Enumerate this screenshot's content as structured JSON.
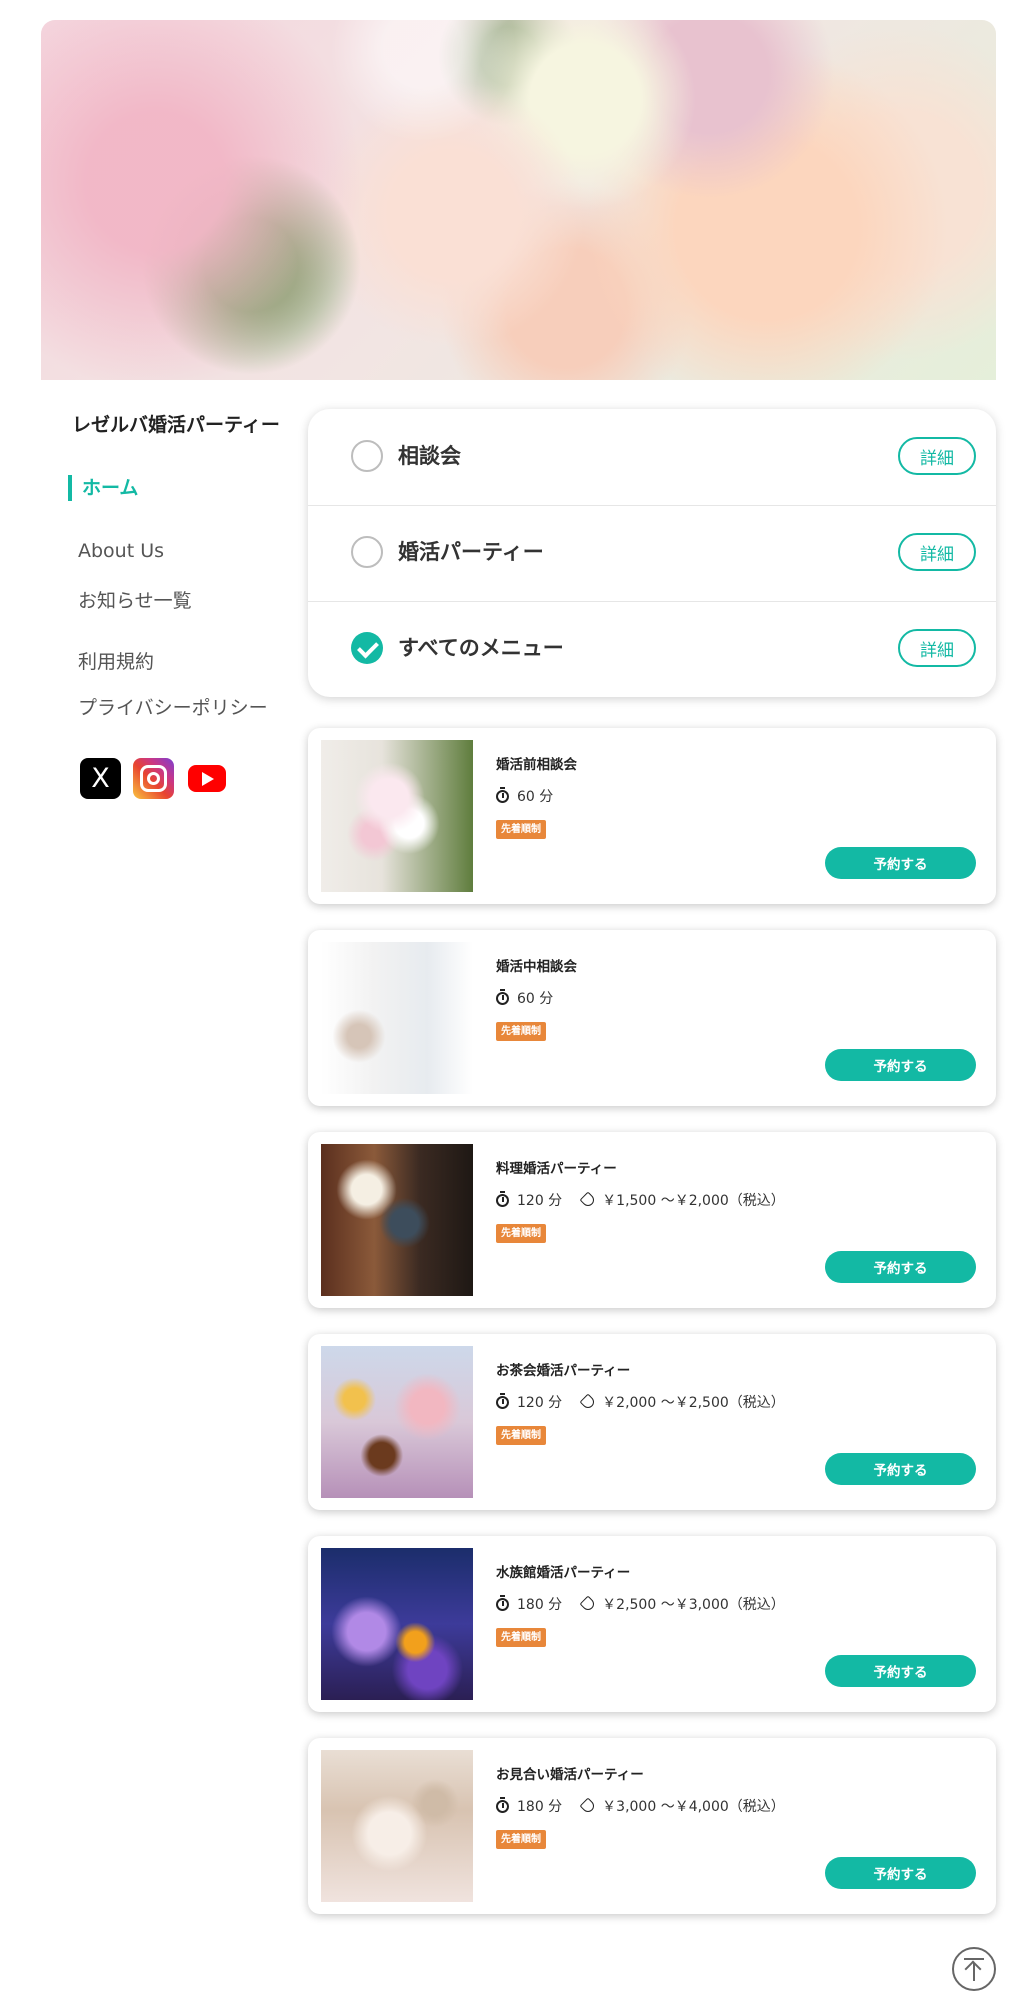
{
  "brand": {
    "accent": "#13b9a4",
    "badge_color": "#e8873a"
  },
  "sidebar": {
    "site_title": "レゼルバ婚活パーティー",
    "home": "ホーム",
    "items": [
      "About Us",
      "お知らせ一覧",
      "利用規約",
      "プライバシーポリシー"
    ],
    "social": [
      "x-icon",
      "instagram-icon",
      "youtube-icon"
    ]
  },
  "filters": [
    {
      "label": "相談会",
      "checked": false,
      "detail": "詳細"
    },
    {
      "label": "婚活パーティー",
      "checked": false,
      "detail": "詳細"
    },
    {
      "label": "すべてのメニュー",
      "checked": true,
      "detail": "詳細"
    }
  ],
  "menus": [
    {
      "title": "婚活前相談会",
      "duration": "60 分",
      "price": "",
      "badge": "先着順制",
      "button": "予約する",
      "photo": "bouquet-photo"
    },
    {
      "title": "婚活中相談会",
      "duration": "60 分",
      "price": "",
      "badge": "先着順制",
      "button": "予約する",
      "photo": "counseling-photo"
    },
    {
      "title": "料理婚活パーティー",
      "duration": "120 分",
      "price": "￥1,500 〜￥2,000（税込）",
      "badge": "先着順制",
      "button": "予約する",
      "photo": "kitchen-photo"
    },
    {
      "title": "お茶会婚活パーティー",
      "duration": "120 分",
      "price": "￥2,000 〜￥2,500（税込）",
      "badge": "先着順制",
      "button": "予約する",
      "photo": "tea-photo"
    },
    {
      "title": "水族館婚活パーティー",
      "duration": "180 分",
      "price": "￥2,500 〜￥3,000（税込）",
      "badge": "先着順制",
      "button": "予約する",
      "photo": "aquarium-photo"
    },
    {
      "title": "お見合い婚活パーティー",
      "duration": "180 分",
      "price": "￥3,000 〜￥4,000（税込）",
      "badge": "先着順制",
      "button": "予約する",
      "photo": "banquet-photo"
    }
  ]
}
